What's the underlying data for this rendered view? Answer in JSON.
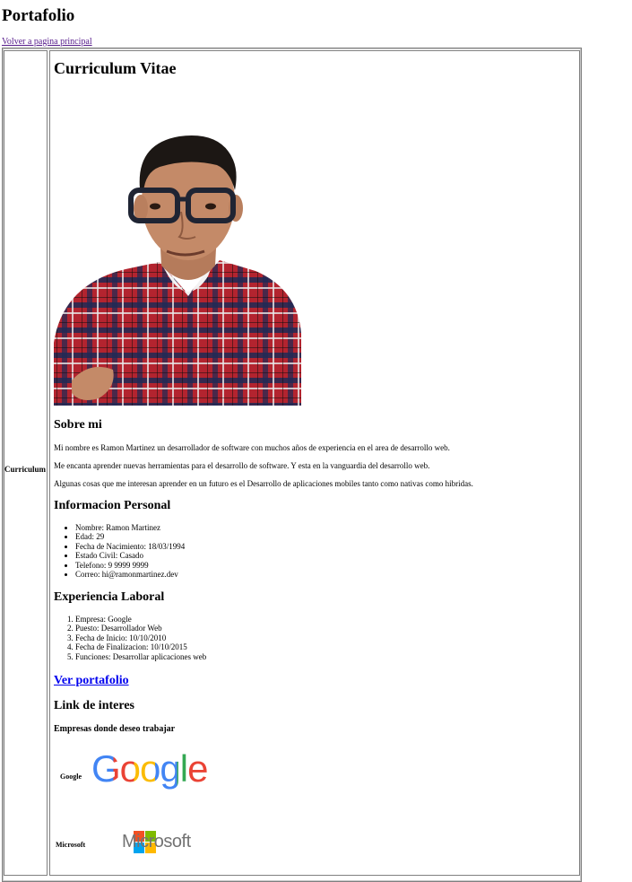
{
  "header": {
    "title": "Portafolio",
    "back_link": "Volver a pagina principal"
  },
  "sidebar": {
    "label": "Curriculum"
  },
  "cv": {
    "title": "Curriculum Vitae",
    "about": {
      "title": "Sobre mi",
      "paragraphs": [
        "Mi nombre es Ramon Martinez un desarrollador de software con muchos años de experiencia en el area de desarrollo web.",
        "Me encanta aprender nuevas herramientas para el desarrollo de software. Y esta en la vanguardia del desarrollo web.",
        "Algunas cosas que me interesan aprender en un futuro es el Desarrollo de aplicaciones mobiles tanto como nativas como hibridas."
      ]
    },
    "personal_info": {
      "title": "Informacion Personal",
      "items": [
        "Nombre: Ramon Martinez",
        "Edad: 29",
        "Fecha de Nacimiento: 18/03/1994",
        "Estado Civil: Casado",
        "Telefono: 9 9999 9999",
        "Correo: hi@ramonmartinez.dev"
      ]
    },
    "experience": {
      "title": "Experiencia Laboral",
      "items": [
        "Empresa: Google",
        "Puesto: Desarrollador Web",
        "Fecha de Inicio: 10/10/2010",
        "Fecha de Finalizacion: 10/10/2015",
        "Funciones: Desarrollar aplicaciones web"
      ]
    },
    "portfolio_link": "Ver portafolio",
    "links": {
      "title": "Link de interes",
      "subtitle": "Empresas donde deseo trabajar",
      "companies": [
        {
          "label": "Google",
          "logo_text": "Google",
          "icon": "google-logo"
        },
        {
          "label": "Microsoft",
          "logo_text": "Microsoft",
          "icon": "microsoft-logo"
        }
      ]
    }
  },
  "colors": {
    "visited_link": "#551a8b",
    "link": "#0000ee",
    "google_blue": "#4285F4",
    "google_red": "#EA4335",
    "google_yellow": "#FBBC05",
    "google_green": "#34A853",
    "ms_red": "#F25022",
    "ms_green": "#7FBA00",
    "ms_blue": "#00A4EF",
    "ms_yellow": "#FFB900",
    "ms_text": "#737373"
  }
}
